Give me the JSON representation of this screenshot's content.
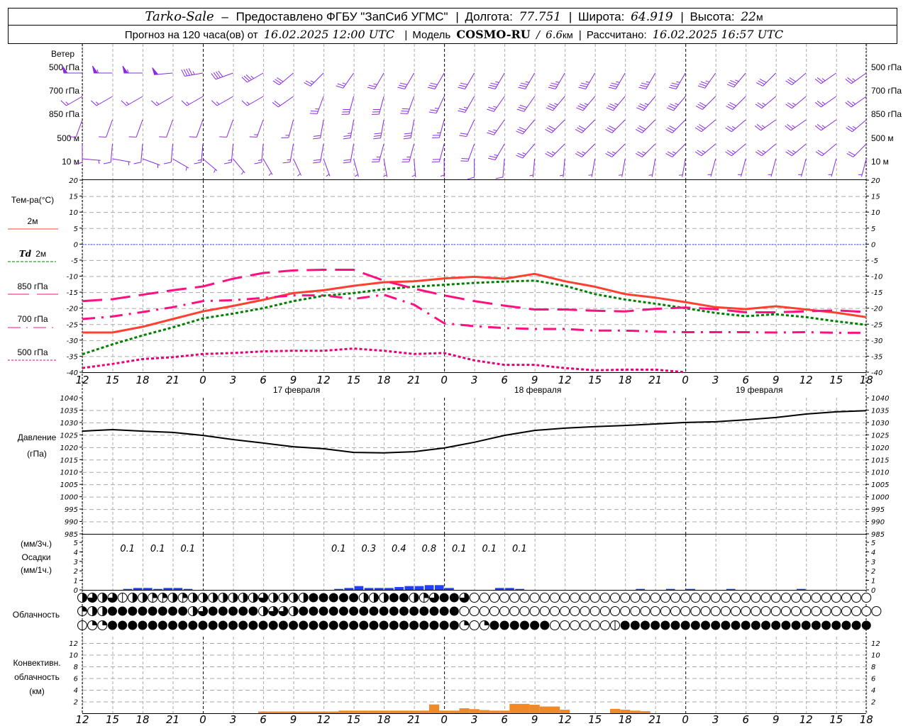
{
  "header": {
    "station": "Tarko-Sale",
    "dash": "–",
    "provider": "Предоставлено ФГБУ \"ЗапСиб УГМС\"",
    "lon_label": "Долгота:",
    "lon": "77.751",
    "lat_label": "Широта:",
    "lat": "64.919",
    "alt_label": "Высота:",
    "alt": "22",
    "alt_unit": "м",
    "forecast_prefix": "Прогноз на 120 часа(ов) от",
    "forecast_start": "16.02.2025 12:00 UTC",
    "model_label": "Модель",
    "model": "COSMO-RU",
    "resolution_sep": "/",
    "resolution": "6.6",
    "resolution_unit": "км",
    "computed_label": "Рассчитано:",
    "computed": "16.02.2025 16:57 UTC"
  },
  "labels": {
    "wind": "Ветер",
    "wind_levels": [
      "500 гПа",
      "700 гПа",
      "850 гПа",
      "500 м",
      "10 м"
    ],
    "temp_title": "Тем-ра(°C)",
    "t2m": "2м",
    "td_prefix": "Td",
    "td_suffix": "2м",
    "l850": "850 гПа",
    "l700": "700 гПа",
    "l500": "500 гПа",
    "pressure": "Давление",
    "pressure_unit": "(гПа)",
    "precip_3h": "(мм/3ч.)",
    "precip": "Осадки",
    "precip_1h": "(мм/1ч.)",
    "clouds": "Облачность",
    "conv1": "Конвективн.",
    "conv2": "облачность",
    "conv3": "(км)"
  },
  "colors": {
    "wind": "#8a2be2",
    "t2m": "#ff4030",
    "td2m": "#008000",
    "t850": "#ff1080",
    "t700": "#ff1080",
    "t500": "#e8007a",
    "zero_line": "#3050ff",
    "precip": "#2040ff",
    "conv": "#f08a28",
    "grid": "#aaaaaa"
  },
  "chart_data": {
    "type": "meteogram",
    "time_step_hours": 3,
    "x_tick_labels": [
      "12",
      "15",
      "18",
      "21",
      "0",
      "3",
      "6",
      "9",
      "12",
      "15",
      "18",
      "21",
      "0",
      "3",
      "6",
      "9",
      "12",
      "15",
      "18",
      "21",
      "0",
      "3",
      "6",
      "9",
      "12",
      "15",
      "18"
    ],
    "day_labels": [
      {
        "label": "17 февраля",
        "at_tick": "12"
      },
      {
        "label": "18 февраля",
        "at_tick": "12"
      },
      {
        "label": "19 февраля",
        "at_tick": "12"
      }
    ],
    "wind": {
      "units": "m/s",
      "levels": [
        {
          "name": "500 гПа",
          "dir": [
            270,
            270,
            270,
            265,
            260,
            250,
            240,
            230,
            225,
            215,
            210,
            210,
            210,
            210,
            210,
            210,
            210,
            210,
            210,
            210,
            210,
            215,
            220,
            225,
            230,
            235,
            235
          ],
          "speed": [
            25,
            27,
            27,
            25,
            22,
            20,
            17,
            15,
            12,
            12,
            12,
            15,
            15,
            15,
            17,
            17,
            18,
            18,
            18,
            18,
            18,
            18,
            18,
            16,
            15,
            13,
            12
          ]
        },
        {
          "name": "700 гПа",
          "dir": [
            240,
            240,
            240,
            240,
            240,
            240,
            240,
            235,
            200,
            195,
            195,
            200,
            205,
            210,
            215,
            215,
            220,
            220,
            220,
            220,
            220,
            225,
            225,
            230,
            230,
            235,
            235
          ],
          "speed": [
            8,
            8,
            8,
            8,
            8,
            8,
            8,
            10,
            12,
            15,
            15,
            15,
            12,
            12,
            13,
            15,
            17,
            18,
            18,
            18,
            18,
            16,
            15,
            14,
            13,
            12,
            12
          ]
        },
        {
          "name": "850 гПа",
          "dir": [
            200,
            200,
            200,
            200,
            200,
            200,
            200,
            195,
            190,
            190,
            190,
            190,
            195,
            205,
            215,
            220,
            225,
            225,
            225,
            225,
            225,
            230,
            230,
            235,
            235,
            235,
            230
          ],
          "speed": [
            6,
            6,
            6,
            6,
            6,
            6,
            7,
            8,
            10,
            13,
            15,
            15,
            12,
            10,
            12,
            15,
            15,
            15,
            15,
            15,
            15,
            15,
            14,
            13,
            12,
            12,
            12
          ]
        },
        {
          "name": "500 м",
          "dir": [
            180,
            185,
            185,
            185,
            185,
            185,
            185,
            190,
            190,
            190,
            195,
            195,
            195,
            200,
            210,
            220,
            225,
            225,
            225,
            225,
            225,
            230,
            230,
            230,
            230,
            230,
            225
          ],
          "speed": [
            6,
            6,
            6,
            6,
            7,
            7,
            7,
            8,
            10,
            11,
            12,
            12,
            10,
            10,
            12,
            12,
            12,
            13,
            12,
            12,
            12,
            12,
            12,
            12,
            12,
            10,
            10
          ]
        },
        {
          "name": "10 м",
          "dir": [
            95,
            100,
            110,
            120,
            130,
            140,
            150,
            155,
            160,
            165,
            170,
            175,
            180,
            180,
            185,
            185,
            185,
            190,
            190,
            190,
            190,
            195,
            195,
            195,
            195,
            195,
            195
          ],
          "speed": [
            2,
            3,
            3,
            3,
            3,
            3,
            3,
            4,
            4,
            4,
            4,
            4,
            4,
            5,
            5,
            4,
            4,
            4,
            3,
            3,
            3,
            3,
            3,
            3,
            3,
            3,
            3
          ]
        }
      ]
    },
    "temperature": {
      "ylim": [
        -40,
        20
      ],
      "yticks": [
        20,
        15,
        10,
        5,
        0,
        -5,
        -10,
        -15,
        -20,
        -25,
        -30,
        -35,
        -40
      ],
      "series": [
        {
          "name": "2м",
          "key": "t2m",
          "values": [
            -27.6,
            -27.6,
            -25.8,
            -23.4,
            -21.0,
            -19.3,
            -17.4,
            -15.3,
            -14.4,
            -13.0,
            -11.9,
            -11.6,
            -10.7,
            -10.2,
            -10.8,
            -9.3,
            -11.6,
            -13.3,
            -15.6,
            -16.7,
            -18.1,
            -19.7,
            -20.3,
            -19.4,
            -20.4,
            -21.4,
            -22.8
          ]
        },
        {
          "name": "Td 2м",
          "key": "td2m",
          "values": [
            -34.4,
            -31.3,
            -28.5,
            -26.0,
            -23.2,
            -21.7,
            -20.0,
            -17.8,
            -16.1,
            -15.3,
            -14.1,
            -13.3,
            -12.7,
            -12.1,
            -11.7,
            -11.4,
            -13.0,
            -15.6,
            -17.3,
            -18.6,
            -20.0,
            -21.5,
            -22.5,
            -21.9,
            -22.8,
            -24.1,
            -25.2
          ]
        },
        {
          "name": "850 гПа",
          "key": "t850",
          "values": [
            -17.8,
            -17.2,
            -15.8,
            -14.4,
            -13.2,
            -10.8,
            -9.0,
            -8.2,
            -8.0,
            -8.0,
            -11.4,
            -13.9,
            -16.0,
            -17.8,
            -19.2,
            -20.4,
            -20.4,
            -20.8,
            -21.0,
            -20.2,
            -19.8,
            -20.3,
            -21.3,
            -21.3,
            -21.0,
            -20.7,
            -21.2
          ]
        },
        {
          "name": "700 гПа",
          "key": "t700",
          "values": [
            -23.4,
            -22.6,
            -21.2,
            -19.7,
            -17.8,
            -17.5,
            -16.8,
            -16.0,
            -16.0,
            -17.1,
            -15.8,
            -18.9,
            -24.7,
            -25.6,
            -26.2,
            -26.5,
            -26.5,
            -27.0,
            -27.0,
            -27.3,
            -27.5,
            -27.5,
            -27.5,
            -27.6,
            -27.5,
            -27.7,
            -27.7
          ]
        },
        {
          "name": "500 гПа",
          "key": "t500",
          "values": [
            -38.7,
            -37.4,
            -35.9,
            -35.3,
            -34.3,
            -34.0,
            -33.5,
            -33.3,
            -33.3,
            -32.6,
            -33.3,
            -34.3,
            -34.0,
            -36.3,
            -37.7,
            -37.7,
            -38.7,
            -39.4,
            -39.2,
            -39.2,
            -40.0,
            null,
            null,
            null,
            null,
            null,
            null
          ]
        }
      ]
    },
    "pressure": {
      "ylim": [
        985,
        1040
      ],
      "yticks": [
        1040,
        1035,
        1030,
        1025,
        1020,
        1015,
        1010,
        1005,
        1000,
        995,
        990,
        985
      ],
      "values": [
        1026.5,
        1027.1,
        1026.5,
        1026.0,
        1024.8,
        1023.1,
        1021.7,
        1020.2,
        1019.4,
        1017.9,
        1017.7,
        1018.2,
        1019.7,
        1022.0,
        1024.8,
        1026.8,
        1027.7,
        1028.3,
        1028.8,
        1029.4,
        1030.0,
        1030.3,
        1031.1,
        1032.0,
        1033.4,
        1034.3,
        1034.8
      ]
    },
    "precipitation": {
      "ylim": [
        0,
        5
      ],
      "yticks": [
        0,
        1,
        2,
        3,
        4,
        5
      ],
      "hourly_mm": [
        0,
        0,
        0,
        0,
        0.1,
        0.2,
        0.2,
        0.1,
        0.2,
        0.2,
        0.1,
        0,
        0,
        0,
        0,
        0,
        0,
        0,
        0,
        0,
        0,
        0,
        0,
        0,
        0,
        0.1,
        0.2,
        0.4,
        0.2,
        0.2,
        0.2,
        0.3,
        0.4,
        0.4,
        0.5,
        0.5,
        0.2,
        0,
        0,
        0,
        0,
        0.2,
        0.2,
        0.1,
        0,
        0,
        0,
        0,
        0,
        0,
        0,
        0,
        0,
        0,
        0,
        0.1,
        0,
        0,
        0.1,
        0,
        0.1,
        0,
        0,
        0,
        0.1,
        0,
        0,
        0,
        0,
        0,
        0,
        0.1,
        0,
        0,
        0,
        0,
        0,
        0
      ],
      "sums_3h": [
        {
          "from_hour": 3,
          "value": "0.1"
        },
        {
          "from_hour": 6,
          "value": "0.1"
        },
        {
          "from_hour": 9,
          "value": "0.1"
        },
        {
          "from_hour": 24,
          "value": "0.1"
        },
        {
          "from_hour": 27,
          "value": "0.3"
        },
        {
          "from_hour": 30,
          "value": "0.4"
        },
        {
          "from_hour": 33,
          "value": "0.8"
        },
        {
          "from_hour": 36,
          "value": "0.1"
        },
        {
          "from_hour": 39,
          "value": "0.1"
        },
        {
          "from_hour": 42,
          "value": "0.1"
        }
      ]
    },
    "cloudiness": {
      "legend": "o=clear, l=line, h=split, q=1/4, b=1/2, t=3/4, f=overcast",
      "rows": [
        "btbtlbbhhbhbbbbbbbtbbbbfffffbbbffbhtfftoooooooooooooooooooooooooooooooooooooooo",
        "hbbffffffffbtfffffbttbffffffffffffffffoooooooooooooooooooooooooooooooooooooooooo",
        "lqqfffffffffffffffffffffffffffffffffffqoqffffffoooooolfffffffffffffffffffffffff"
      ]
    },
    "convective_cloud": {
      "units": "km",
      "ylim": [
        0,
        13
      ],
      "yticks": [
        2,
        4,
        6,
        8,
        10,
        12
      ],
      "hourly_km": [
        0,
        0,
        0,
        0,
        0,
        0,
        0,
        0,
        0,
        0,
        0,
        0,
        0,
        0,
        0,
        0,
        0,
        0,
        0.3,
        0.3,
        0.3,
        0.3,
        0.3,
        0.3,
        0.3,
        0.3,
        0.45,
        0.45,
        0.45,
        0.45,
        0.45,
        0.45,
        0.45,
        0.45,
        0.45,
        1.5,
        0.45,
        0.45,
        0.85,
        0.7,
        0.55,
        0.45,
        0.45,
        1.6,
        1.6,
        1.45,
        1.15,
        1.15,
        0.6,
        0,
        0,
        0,
        0,
        0.75,
        0.6,
        0.45,
        0.35,
        0,
        0,
        0,
        0,
        0,
        0,
        0,
        0,
        0,
        0,
        0,
        0,
        0,
        0,
        0,
        0,
        0,
        0,
        0,
        0,
        0,
        0
      ]
    }
  }
}
